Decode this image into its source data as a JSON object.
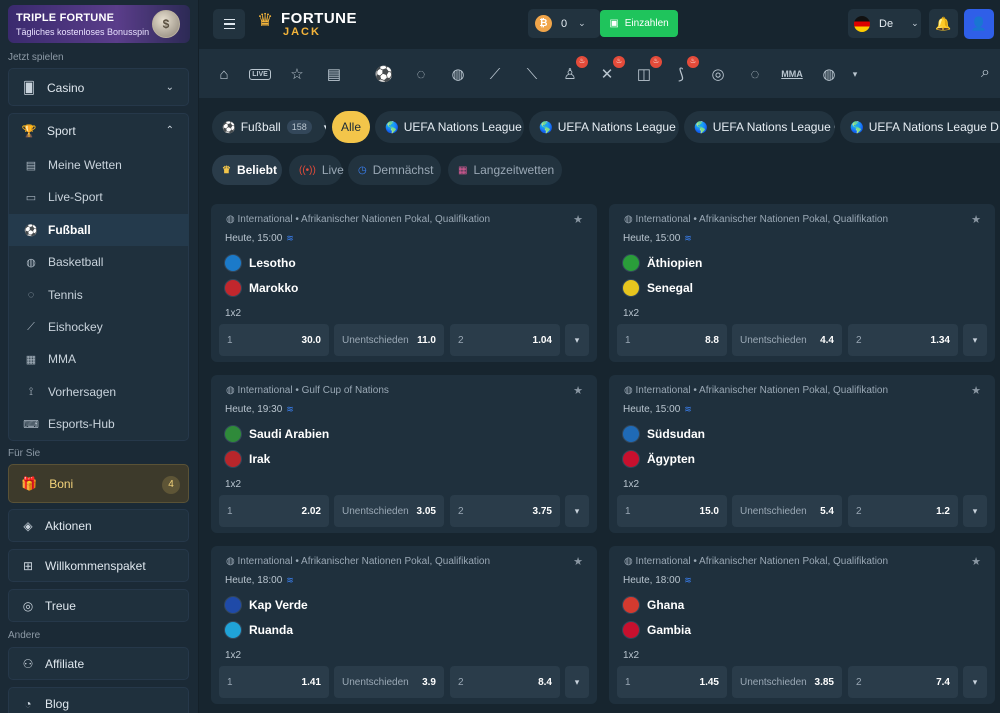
{
  "promo": {
    "title": "TRIPLE FORTUNE",
    "subtitle": "Tägliches kostenloses Bonusspin",
    "coin": "$"
  },
  "sidebar": {
    "section_play": "Jetzt spielen",
    "casino": "Casino",
    "sport": "Sport",
    "sub_items": [
      {
        "label": "Meine Wetten",
        "icon": "receipt-icon"
      },
      {
        "label": "Live-Sport",
        "icon": "tv-icon"
      },
      {
        "label": "Fußball",
        "icon": "soccer-ball-icon"
      },
      {
        "label": "Basketball",
        "icon": "basketball-icon"
      },
      {
        "label": "Tennis",
        "icon": "tennis-icon"
      },
      {
        "label": "Eishockey",
        "icon": "hockey-icon"
      },
      {
        "label": "MMA",
        "icon": "mma-icon"
      },
      {
        "label": "Vorhersagen",
        "icon": "prediction-icon"
      },
      {
        "label": "Esports-Hub",
        "icon": "gamepad-icon"
      }
    ],
    "section_you": "Für Sie",
    "boni": "Boni",
    "boni_count": "4",
    "aktionen": "Aktionen",
    "willkommen": "Willkommenspaket",
    "treue": "Treue",
    "section_other": "Andere",
    "affiliate": "Affiliate",
    "blog": "Blog"
  },
  "header": {
    "logo_top": "FORTUNE",
    "logo_bottom": "JACK",
    "balance": "0",
    "deposit": "Einzahlen",
    "lang": "De"
  },
  "sportbar": {
    "live": "LIVE",
    "mma": "MMA"
  },
  "filters": {
    "sport": "Fußball",
    "sport_count": "158",
    "all": "Alle",
    "leagues": [
      "UEFA Nations League A",
      "UEFA Nations League B",
      "UEFA Nations League C",
      "UEFA Nations League D"
    ]
  },
  "tabs": [
    "Beliebt",
    "Live",
    "Demnächst",
    "Langzeitwetten"
  ],
  "market": "1x2",
  "draw_label": "Unentschieden",
  "matches": [
    {
      "league": "International • Afrikanischer Nationen Pokal, Qualifikation",
      "time": "Heute, 15:00",
      "home": "Lesotho",
      "away": "Marokko",
      "o1": "30.0",
      "ox": "11.0",
      "o2": "1.04",
      "home_color": "#1b7ac9",
      "away_color": "#c1272d"
    },
    {
      "league": "International • Afrikanischer Nationen Pokal, Qualifikation",
      "time": "Heute, 15:00",
      "home": "Äthiopien",
      "away": "Senegal",
      "o1": "8.8",
      "ox": "4.4",
      "o2": "1.34",
      "home_color": "#2a9d3a",
      "away_color": "#e7c51e"
    },
    {
      "league": "International • Gulf Cup of Nations",
      "time": "Heute, 19:30",
      "home": "Saudi Arabien",
      "away": "Irak",
      "o1": "2.02",
      "ox": "3.05",
      "o2": "3.75",
      "home_color": "#2f8a3a",
      "away_color": "#b8262b"
    },
    {
      "league": "International • Afrikanischer Nationen Pokal, Qualifikation",
      "time": "Heute, 15:00",
      "home": "Südsudan",
      "away": "Ägypten",
      "o1": "15.0",
      "ox": "5.4",
      "o2": "1.2",
      "home_color": "#1f6ab6",
      "away_color": "#c8102e"
    },
    {
      "league": "International • Afrikanischer Nationen Pokal, Qualifikation",
      "time": "Heute, 18:00",
      "home": "Kap Verde",
      "away": "Ruanda",
      "o1": "1.41",
      "ox": "3.9",
      "o2": "8.4",
      "home_color": "#1f4aa8",
      "away_color": "#20a3d8"
    },
    {
      "league": "International • Afrikanischer Nationen Pokal, Qualifikation",
      "time": "Heute, 18:00",
      "home": "Ghana",
      "away": "Gambia",
      "o1": "1.45",
      "ox": "3.85",
      "o2": "7.4",
      "home_color": "#d43a2f",
      "away_color": "#c8102e"
    }
  ]
}
